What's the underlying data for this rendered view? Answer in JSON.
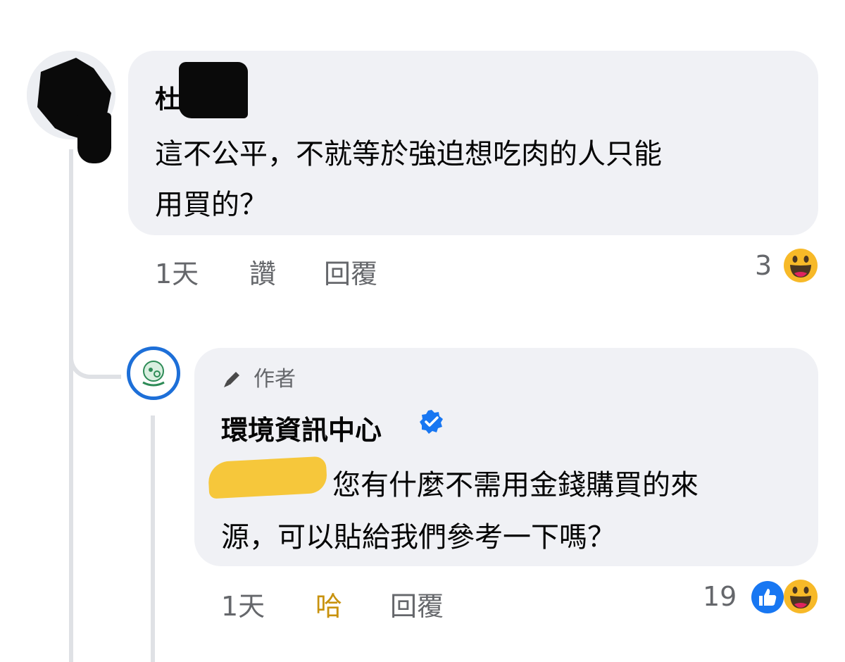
{
  "comment1": {
    "author_visible": "杜",
    "text_line1": "這不公平，不就等於強迫想吃肉的人只能",
    "text_line2": "用買的？",
    "time": "1天",
    "like": "讚",
    "reply": "回覆",
    "reaction_count": "3",
    "reactions": [
      "haha-icon"
    ]
  },
  "comment2": {
    "badge": "作者",
    "author": "環境資訊中心",
    "verified": true,
    "text_line1": "您有什麼不需用金錢購買的來",
    "text_line2": "源，可以貼給我們參考一下嗎？",
    "time": "1天",
    "reaction_selected": "哈",
    "reply": "回覆",
    "reaction_count": "19",
    "reactions": [
      "like-icon",
      "haha-icon"
    ]
  },
  "colors": {
    "bubble": "#f0f1f5",
    "verified_blue": "#1877f2",
    "haha_selected": "#c8920e",
    "meta_gray": "#65676b",
    "page_avatar_ring": "#1d6fd8",
    "highlight_yellow": "#f6c73b"
  }
}
